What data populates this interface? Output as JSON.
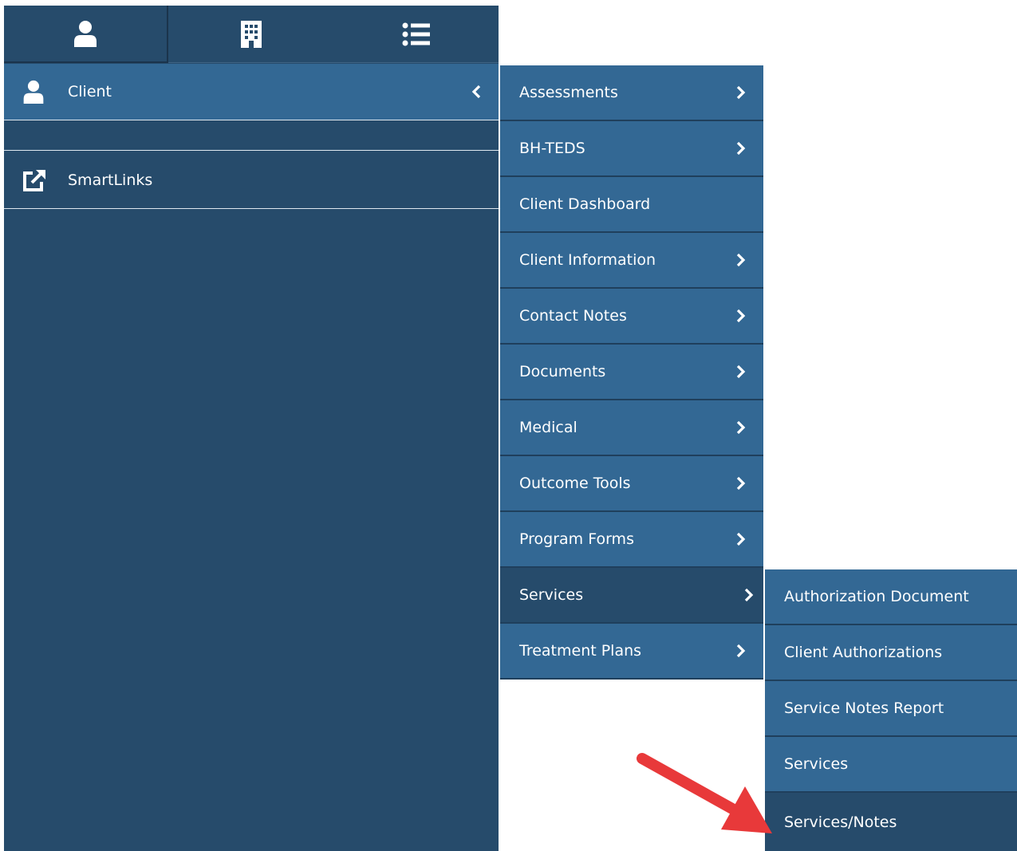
{
  "colors": {
    "sidebar_bg": "#264b6b",
    "item_bg": "#336894",
    "active_bg": "#264b6b",
    "annotation_arrow": "#e8393a"
  },
  "tabs": [
    {
      "icon": "person-icon"
    },
    {
      "icon": "building-icon"
    },
    {
      "icon": "list-icon"
    }
  ],
  "sidebar": {
    "client_label": "Client",
    "smartlinks_label": "SmartLinks"
  },
  "client_menu": [
    {
      "label": "Assessments",
      "has_submenu": true
    },
    {
      "label": "BH-TEDS",
      "has_submenu": true
    },
    {
      "label": "Client Dashboard",
      "has_submenu": false
    },
    {
      "label": "Client Information",
      "has_submenu": true
    },
    {
      "label": "Contact Notes",
      "has_submenu": true
    },
    {
      "label": "Documents",
      "has_submenu": true
    },
    {
      "label": "Medical",
      "has_submenu": true
    },
    {
      "label": "Outcome Tools",
      "has_submenu": true
    },
    {
      "label": "Program Forms",
      "has_submenu": true
    },
    {
      "label": "Services",
      "has_submenu": true,
      "active": true
    },
    {
      "label": "Treatment Plans",
      "has_submenu": true
    }
  ],
  "services_menu": [
    {
      "label": "Authorization Document"
    },
    {
      "label": "Client Authorizations"
    },
    {
      "label": "Service Notes Report"
    },
    {
      "label": "Services"
    },
    {
      "label": "Services/Notes",
      "active": true
    }
  ]
}
